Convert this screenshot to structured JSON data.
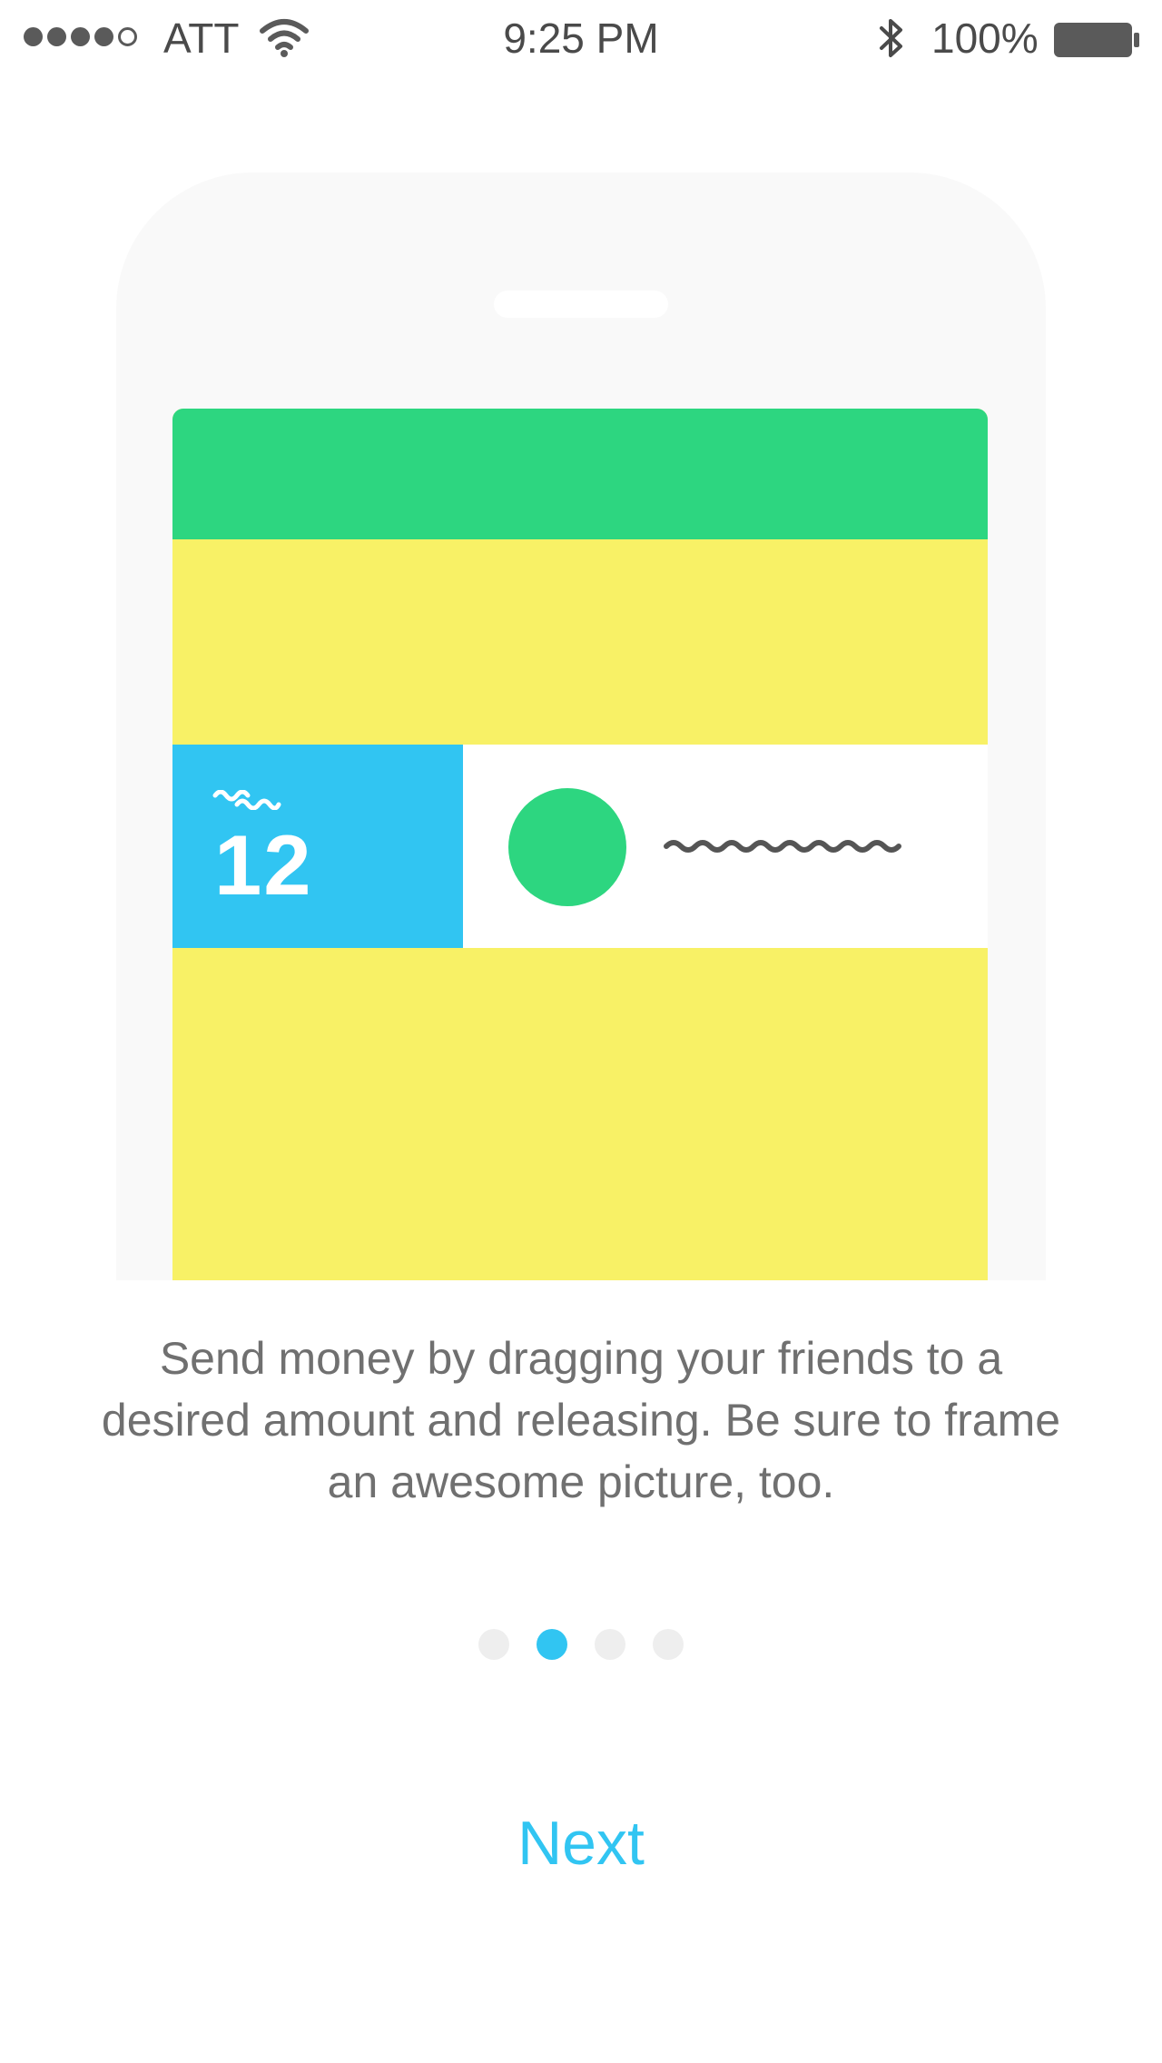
{
  "status_bar": {
    "carrier": "ATT",
    "time": "9:25 PM",
    "battery_percent": "100%",
    "signal_bars_filled": 4,
    "signal_bars_total": 5,
    "icons": [
      "signal-dots-icon",
      "wifi-icon",
      "bluetooth-icon",
      "battery-icon"
    ]
  },
  "illustration": {
    "amount": "12",
    "colors": {
      "nav_bar": "#2dd680",
      "background": "#f8f166",
      "amount_block": "#31c5f2",
      "avatar": "#2dd680",
      "phone_frame": "#f9f9f9"
    }
  },
  "onboarding": {
    "description": "Send money by dragging your friends to a desired amount and releasing. Be sure to frame an awesome picture, too.",
    "page_count": 4,
    "current_page": 2,
    "next_label": "Next"
  },
  "colors": {
    "accent": "#31c5f2",
    "text_secondary": "#707070",
    "dot_inactive": "#eeeeee"
  }
}
